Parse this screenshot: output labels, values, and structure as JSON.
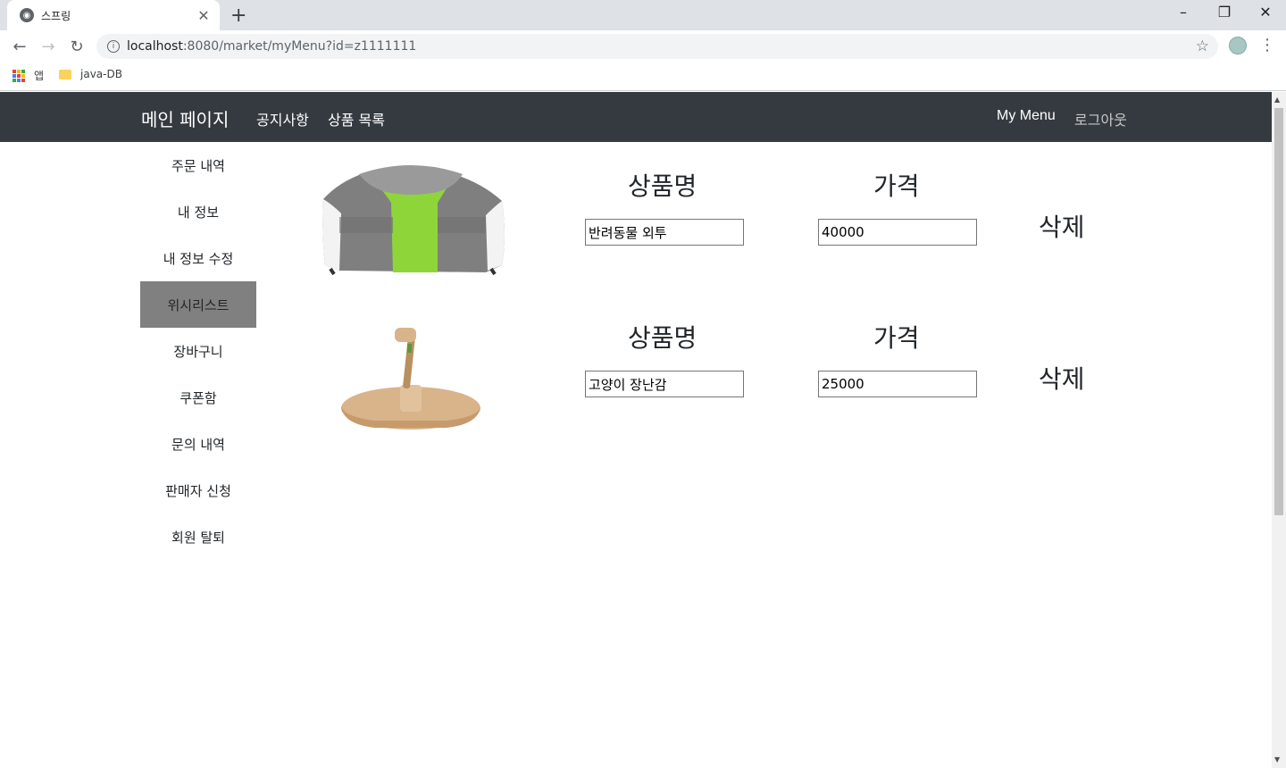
{
  "browser": {
    "tab_title": "스프링",
    "url_host": "localhost",
    "url_rest": ":8080/market/myMenu?id=z1111111",
    "bookmarks": [
      {
        "label": "앱",
        "icon": "apps-grid-icon"
      },
      {
        "label": "java-DB",
        "icon": "folder-icon"
      }
    ]
  },
  "navbar": {
    "brand": "메인 페이지",
    "links": [
      "공지사항",
      "상품 목록"
    ],
    "my_menu": "My Menu",
    "logout": "로그아웃"
  },
  "sidebar": {
    "items": [
      {
        "label": "주문 내역",
        "active": false
      },
      {
        "label": "내 정보",
        "active": false
      },
      {
        "label": "내 정보 수정",
        "active": false
      },
      {
        "label": "위시리스트",
        "active": true
      },
      {
        "label": "장바구니",
        "active": false
      },
      {
        "label": "쿠폰함",
        "active": false
      },
      {
        "label": "문의 내역",
        "active": false
      },
      {
        "label": "판매자 신청",
        "active": false
      },
      {
        "label": "회원 탈퇴",
        "active": false
      }
    ]
  },
  "wishlist": {
    "name_header": "상품명",
    "price_header": "가격",
    "delete_label": "삭제",
    "items": [
      {
        "name": "반려동물 외투",
        "price": "40000",
        "image": "pet-coat-image"
      },
      {
        "name": "고양이 장난감",
        "price": "25000",
        "image": "cat-toy-image"
      }
    ]
  },
  "colors": {
    "navbar_bg": "#343a40",
    "sidebar_active_bg": "#808080"
  }
}
